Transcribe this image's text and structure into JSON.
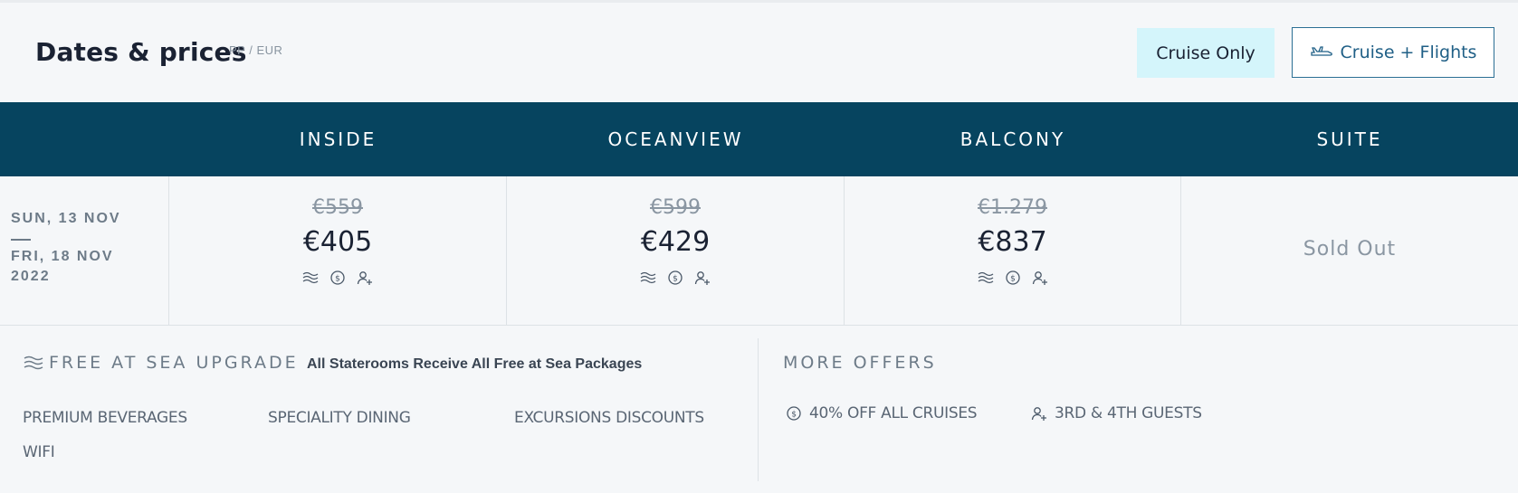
{
  "header": {
    "title": "Dates & prices",
    "subtitle": "PP / EUR",
    "cruise_only_label": "Cruise Only",
    "cruise_flights_label": "Cruise + Flights"
  },
  "table": {
    "columns": [
      "INSIDE",
      "OCEANVIEW",
      "BALCONY",
      "SUITE"
    ],
    "row": {
      "date_start": "SUN, 13 NOV",
      "date_end": "FRI, 18 NOV",
      "year": "2022",
      "prices": [
        {
          "old": "€559",
          "new": "€405"
        },
        {
          "old": "€599",
          "new": "€429"
        },
        {
          "old": "€1.279",
          "new": "€837"
        }
      ],
      "suite_status": "Sold Out"
    }
  },
  "free_at_sea": {
    "title": "FREE AT SEA UPGRADE",
    "description": "All Staterooms Receive All Free at Sea Packages",
    "perks": [
      "PREMIUM BEVERAGES",
      "SPECIALITY DINING",
      "EXCURSIONS DISCOUNTS",
      "WIFI"
    ]
  },
  "more_offers": {
    "title": "MORE OFFERS",
    "offers": [
      "40% OFF ALL CRUISES",
      "3RD & 4TH GUESTS"
    ]
  },
  "colors": {
    "header_bg": "#06445f",
    "cruise_only_bg": "#d4f5fb",
    "accent": "#1f5f86"
  }
}
